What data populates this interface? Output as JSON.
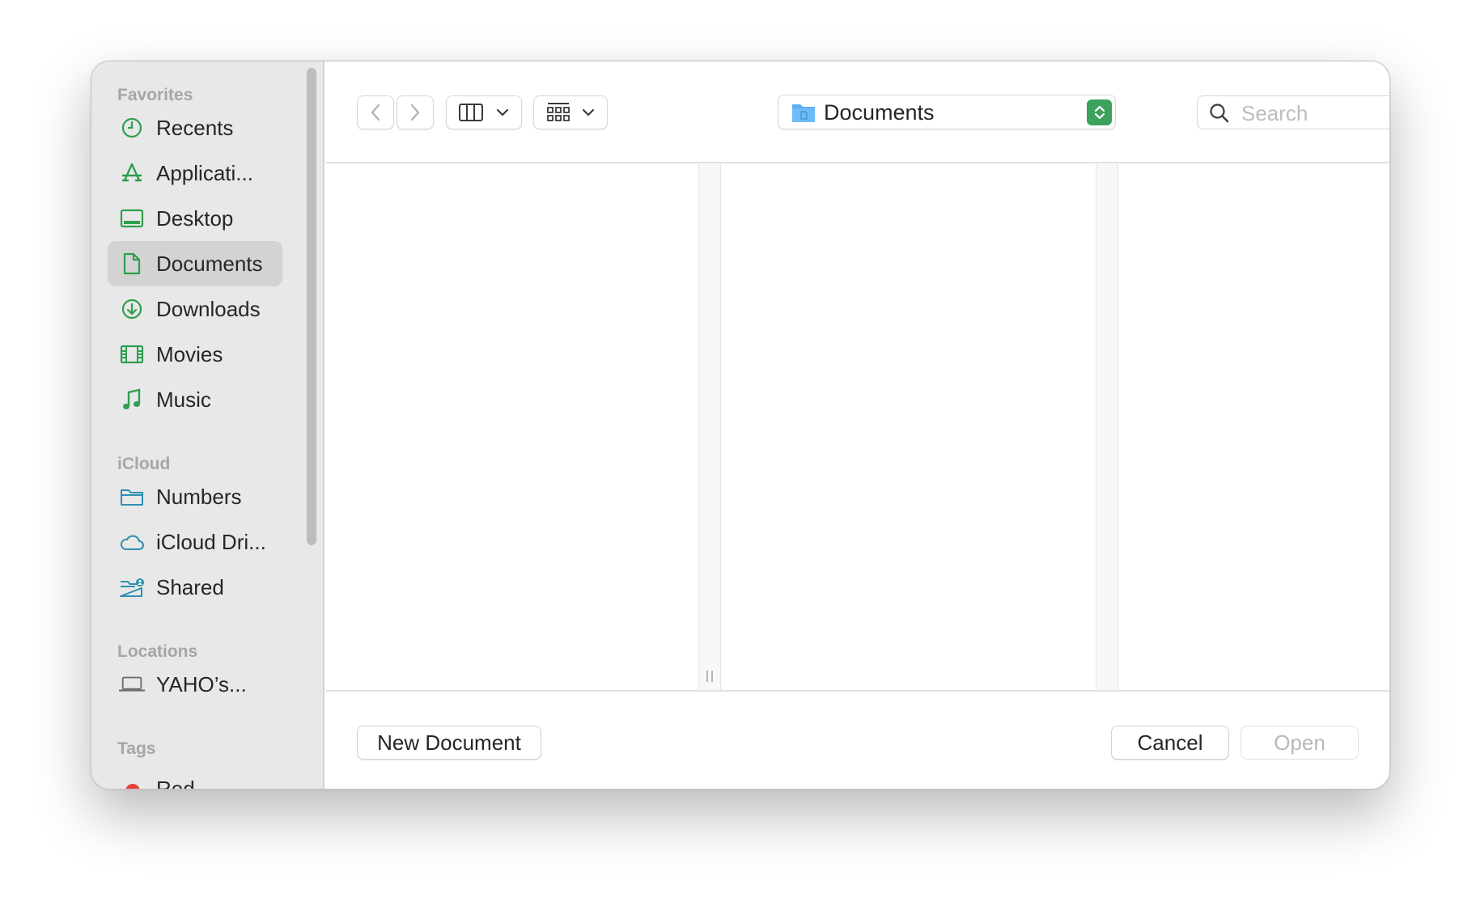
{
  "sidebar": {
    "sections": {
      "favorites": "Favorites",
      "icloud": "iCloud",
      "locations": "Locations",
      "tags": "Tags"
    },
    "favorites": [
      {
        "label": "Recents",
        "icon": "clock-icon"
      },
      {
        "label": "Applicati...",
        "icon": "applications-icon"
      },
      {
        "label": "Desktop",
        "icon": "desktop-icon"
      },
      {
        "label": "Documents",
        "icon": "document-icon",
        "selected": true
      },
      {
        "label": "Downloads",
        "icon": "download-icon"
      },
      {
        "label": "Movies",
        "icon": "film-icon"
      },
      {
        "label": "Music",
        "icon": "music-note-icon"
      }
    ],
    "icloud": [
      {
        "label": "Numbers",
        "icon": "folder-icon"
      },
      {
        "label": "iCloud Dri...",
        "icon": "cloud-icon"
      },
      {
        "label": "Shared",
        "icon": "shared-folder-icon"
      }
    ],
    "locations": [
      {
        "label": "YAHO’s...",
        "icon": "laptop-icon"
      }
    ],
    "tags": [
      {
        "label": "Red",
        "color": "#e6423b"
      }
    ]
  },
  "toolbar": {
    "path_label": "Documents",
    "search_placeholder": "Search"
  },
  "footer": {
    "new_document": "New Document",
    "cancel": "Cancel",
    "open": "Open"
  },
  "colors": {
    "accent": "#28a745",
    "icon_green": "#2e9e4f",
    "icon_teal": "#2f8fb0",
    "selection": "#d3d3d3"
  }
}
